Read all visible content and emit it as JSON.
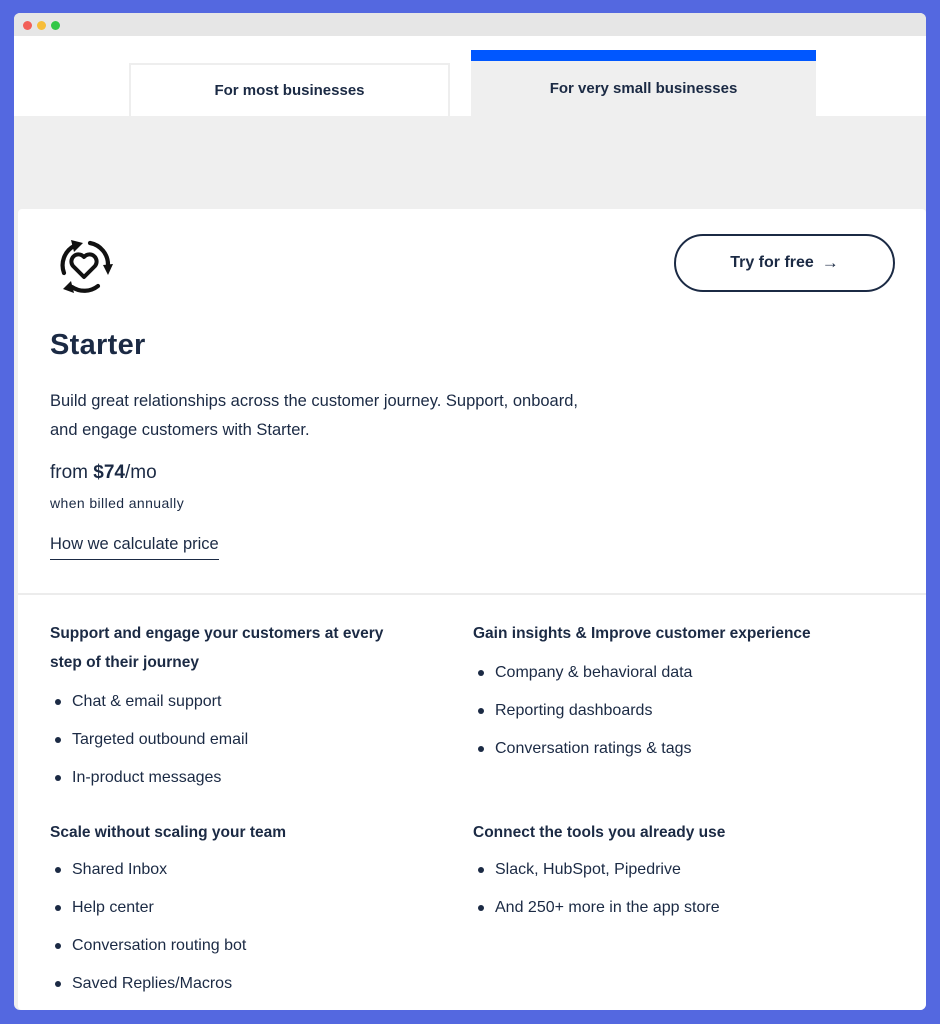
{
  "tabs": [
    {
      "label": "For most businesses",
      "active": false
    },
    {
      "label": "For very small businesses",
      "active": true
    }
  ],
  "colors": {
    "background": "#5468e0",
    "active_tab_bar": "#0057ff",
    "text": "#1b2a44"
  },
  "plan": {
    "icon": "heart-cycle-icon",
    "name": "Starter",
    "description": "Build great relationships across the customer journey. Support, onboard, and engage customers with Starter.",
    "price_prefix": "from ",
    "price_amount": "$74",
    "price_suffix": "/mo",
    "billing_note": "when billed annually",
    "calc_link": "How we calculate price",
    "cta_label": "Try for free",
    "cta_icon": "arrow-right-icon"
  },
  "feature_groups": [
    {
      "title": "Support and engage your customers at every step of their journey",
      "items": [
        "Chat & email support",
        "Targeted outbound email",
        "In-product messages"
      ]
    },
    {
      "title": "Gain insights & Improve customer experience",
      "items": [
        "Company & behavioral data",
        "Reporting dashboards",
        "Conversation ratings & tags"
      ]
    },
    {
      "title": "Scale without scaling your team",
      "items": [
        "Shared Inbox",
        "Help center",
        "Conversation routing bot",
        "Saved Replies/Macros"
      ]
    },
    {
      "title": "Connect the tools you already use",
      "items": [
        "Slack, HubSpot, Pipedrive",
        "And 250+ more in the app store"
      ]
    }
  ]
}
